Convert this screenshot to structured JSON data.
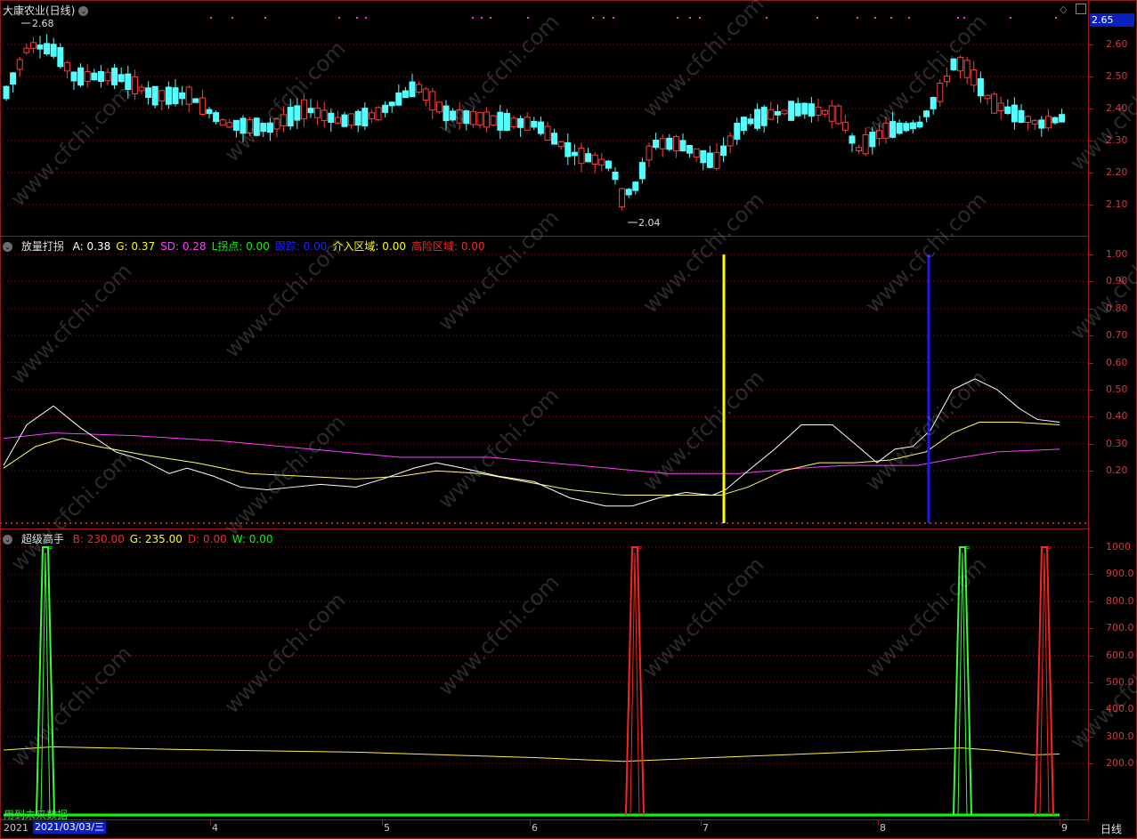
{
  "stock": {
    "title": "大康农业(日线)",
    "last_price": "2.65",
    "high_label": "2.68",
    "low_label": "2.04",
    "price_axis": [
      "2.60",
      "2.50",
      "2.40",
      "2.30",
      "2.20",
      "2.10"
    ]
  },
  "panel2": {
    "name": "放量打拐",
    "items": [
      {
        "label": "A: 0.38",
        "color": "#ffffff"
      },
      {
        "label": "G: 0.37",
        "color": "#ffff00"
      },
      {
        "label": "SD: 0.28",
        "color": "#ff3cff"
      },
      {
        "label": "L拐点: 0.00",
        "color": "#00ff00"
      },
      {
        "label": "跟踪: 0.00",
        "color": "#2222ff"
      },
      {
        "label": "介入区域: 0.00",
        "color": "#ffff00"
      },
      {
        "label": "高险区域: 0.00",
        "color": "#ff2222"
      }
    ],
    "axis": [
      "1.00",
      "0.90",
      "0.80",
      "0.70",
      "0.60",
      "0.50",
      "0.40",
      "0.30",
      "0.20"
    ]
  },
  "panel3": {
    "name": "超级高手",
    "items": [
      {
        "label": "B: 230.00",
        "color": "#ff2222"
      },
      {
        "label": "G: 235.00",
        "color": "#ffff00"
      },
      {
        "label": "D: 0.00",
        "color": "#ff2222"
      },
      {
        "label": "W: 0.00",
        "color": "#00ff00"
      }
    ],
    "axis": [
      "1000",
      "900.0",
      "800.0",
      "700.0",
      "600.0",
      "500.0",
      "400.0",
      "300.0",
      "200.0"
    ]
  },
  "footer": {
    "note": "用到未来数据",
    "date_cursor": "2021/03/03/三",
    "date_start": "2021",
    "months": [
      "4",
      "5",
      "6",
      "7",
      "8",
      "9"
    ],
    "period": "日线"
  },
  "watermark": "www.cfchi.com"
}
